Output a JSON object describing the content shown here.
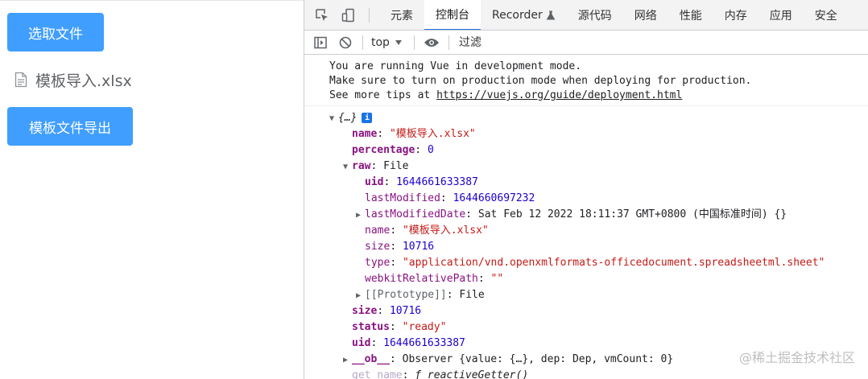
{
  "app": {
    "select_button": "选取文件",
    "file_name": "模板导入.xlsx",
    "export_button": "模板文件导出",
    "accent": "#409eff"
  },
  "devtools": {
    "tabs": [
      "元素",
      "控制台",
      "Recorder",
      "源代码",
      "网络",
      "性能",
      "内存",
      "应用",
      "安全"
    ],
    "active_tab": "控制台",
    "context": "top",
    "filter_placeholder": "过滤",
    "console_message": {
      "line1": "You are running Vue in development mode.",
      "line2": "Make sure to turn on production mode when deploying for production.",
      "line3_prefix": "See more tips at ",
      "link": "https://vuejs.org/guide/deployment.html"
    },
    "object": {
      "summary": "{…}",
      "name_key": "name",
      "name_val": "\"模板导入.xlsx\"",
      "percentage_key": "percentage",
      "percentage_val": "0",
      "raw_key": "raw",
      "raw_val": "File",
      "raw_uid_key": "uid",
      "raw_uid_val": "1644661633387",
      "raw_lastModified_key": "lastModified",
      "raw_lastModified_val": "1644660697232",
      "raw_lastModifiedDate_key": "lastModifiedDate",
      "raw_lastModifiedDate_val": "Sat Feb 12 2022 18:11:37 GMT+0800 (中国标准时间) {}",
      "raw_name_key": "name",
      "raw_name_val": "\"模板导入.xlsx\"",
      "raw_size_key": "size",
      "raw_size_val": "10716",
      "raw_type_key": "type",
      "raw_type_val": "\"application/vnd.openxmlformats-officedocument.spreadsheetml.sheet\"",
      "raw_webkit_key": "webkitRelativePath",
      "raw_webkit_val": "\"\"",
      "raw_proto_key": "[[Prototype]]",
      "raw_proto_val": "File",
      "size_key": "size",
      "size_val": "10716",
      "status_key": "status",
      "status_val": "\"ready\"",
      "uid_key": "uid",
      "uid_val": "1644661633387",
      "ob_key": "__ob__",
      "ob_val": "Observer {value: {…}, dep: Dep, vmCount: 0}",
      "getname_key": "get name",
      "getname_val": "ƒ reactiveGetter()"
    }
  },
  "watermark": "@稀土掘金技术社区"
}
